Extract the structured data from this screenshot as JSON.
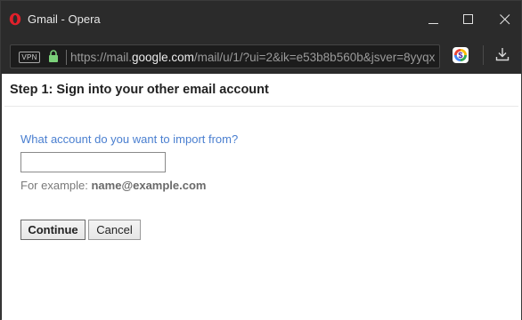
{
  "window": {
    "title": "Gmail - Opera"
  },
  "address_bar": {
    "vpn_label": "VPN",
    "url_prefix": "https://mail.",
    "url_host": "google.com",
    "url_suffix": "/mail/u/1/?ui=2&ik=e53b8b560b&jsver=8yyqx"
  },
  "page": {
    "step_title": "Step 1: Sign into your other email account",
    "question": "What account do you want to import from?",
    "input_value": "",
    "example_prefix": "For example: ",
    "example_value": "name@example.com",
    "continue_label": "Continue",
    "cancel_label": "Cancel"
  },
  "colors": {
    "question_blue": "#4a7fd0",
    "lock_green": "#7bd17a",
    "opera_red": "#e0202b"
  }
}
